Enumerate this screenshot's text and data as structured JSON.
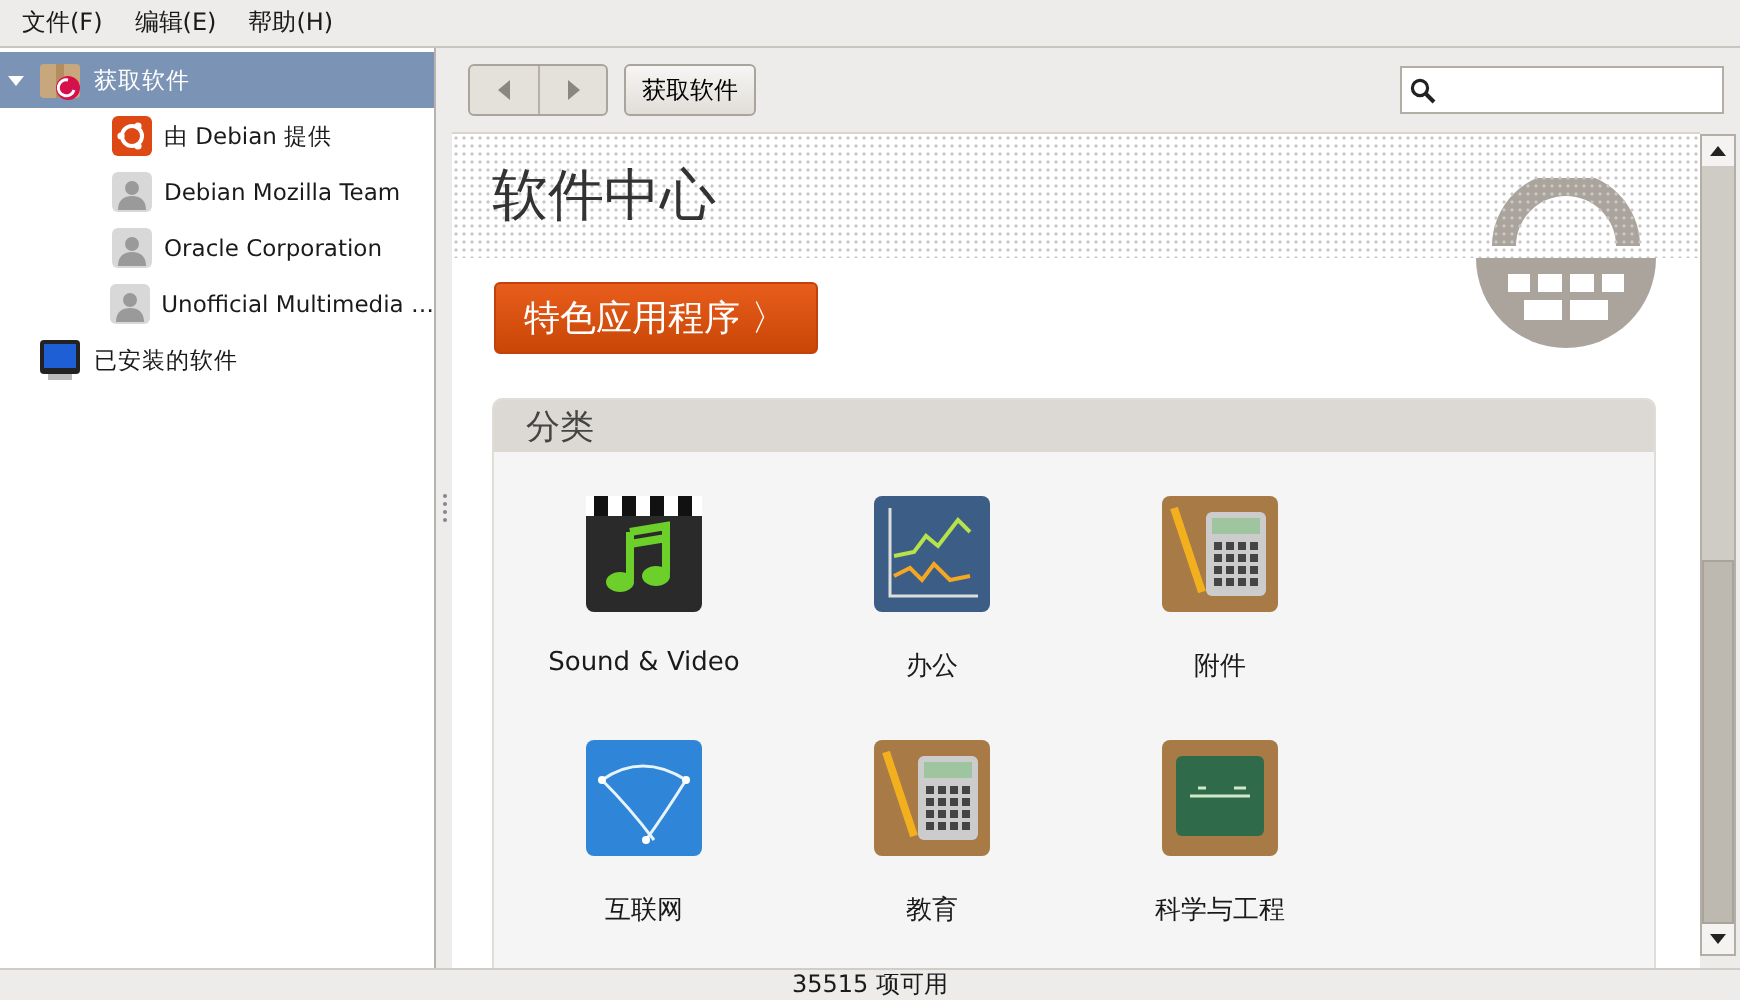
{
  "menu": [
    "文件(F)",
    "编辑(E)",
    "帮助(H)"
  ],
  "sidebar": {
    "items": [
      {
        "label": "获取软件",
        "kind": "software-source",
        "selected": true,
        "expanded": true,
        "children": [
          {
            "label": "由 Debian 提供",
            "kind": "distribution",
            "selected": false
          },
          {
            "label": "Debian Mozilla Team",
            "kind": "person",
            "selected": false
          },
          {
            "label": "Oracle Corporation",
            "kind": "person",
            "selected": false
          },
          {
            "label": "Unofficial Multimedia …",
            "kind": "person",
            "selected": false
          }
        ]
      },
      {
        "label": "已安装的软件",
        "kind": "installed",
        "selected": false
      }
    ]
  },
  "toolbar": {
    "breadcrumb": "获取软件"
  },
  "header": {
    "title": "软件中心",
    "featured_button": "特色应用程序 〉"
  },
  "categories": {
    "title": "分类",
    "items": [
      {
        "label": "Sound & Video",
        "kind": "media"
      },
      {
        "label": "办公",
        "kind": "chart"
      },
      {
        "label": "附件",
        "kind": "calculator"
      },
      {
        "label": "互联网",
        "kind": "globe"
      },
      {
        "label": "教育",
        "kind": "calculator"
      },
      {
        "label": "科学与工程",
        "kind": "chalkboard"
      }
    ]
  },
  "status_bar": "35515 项可用"
}
